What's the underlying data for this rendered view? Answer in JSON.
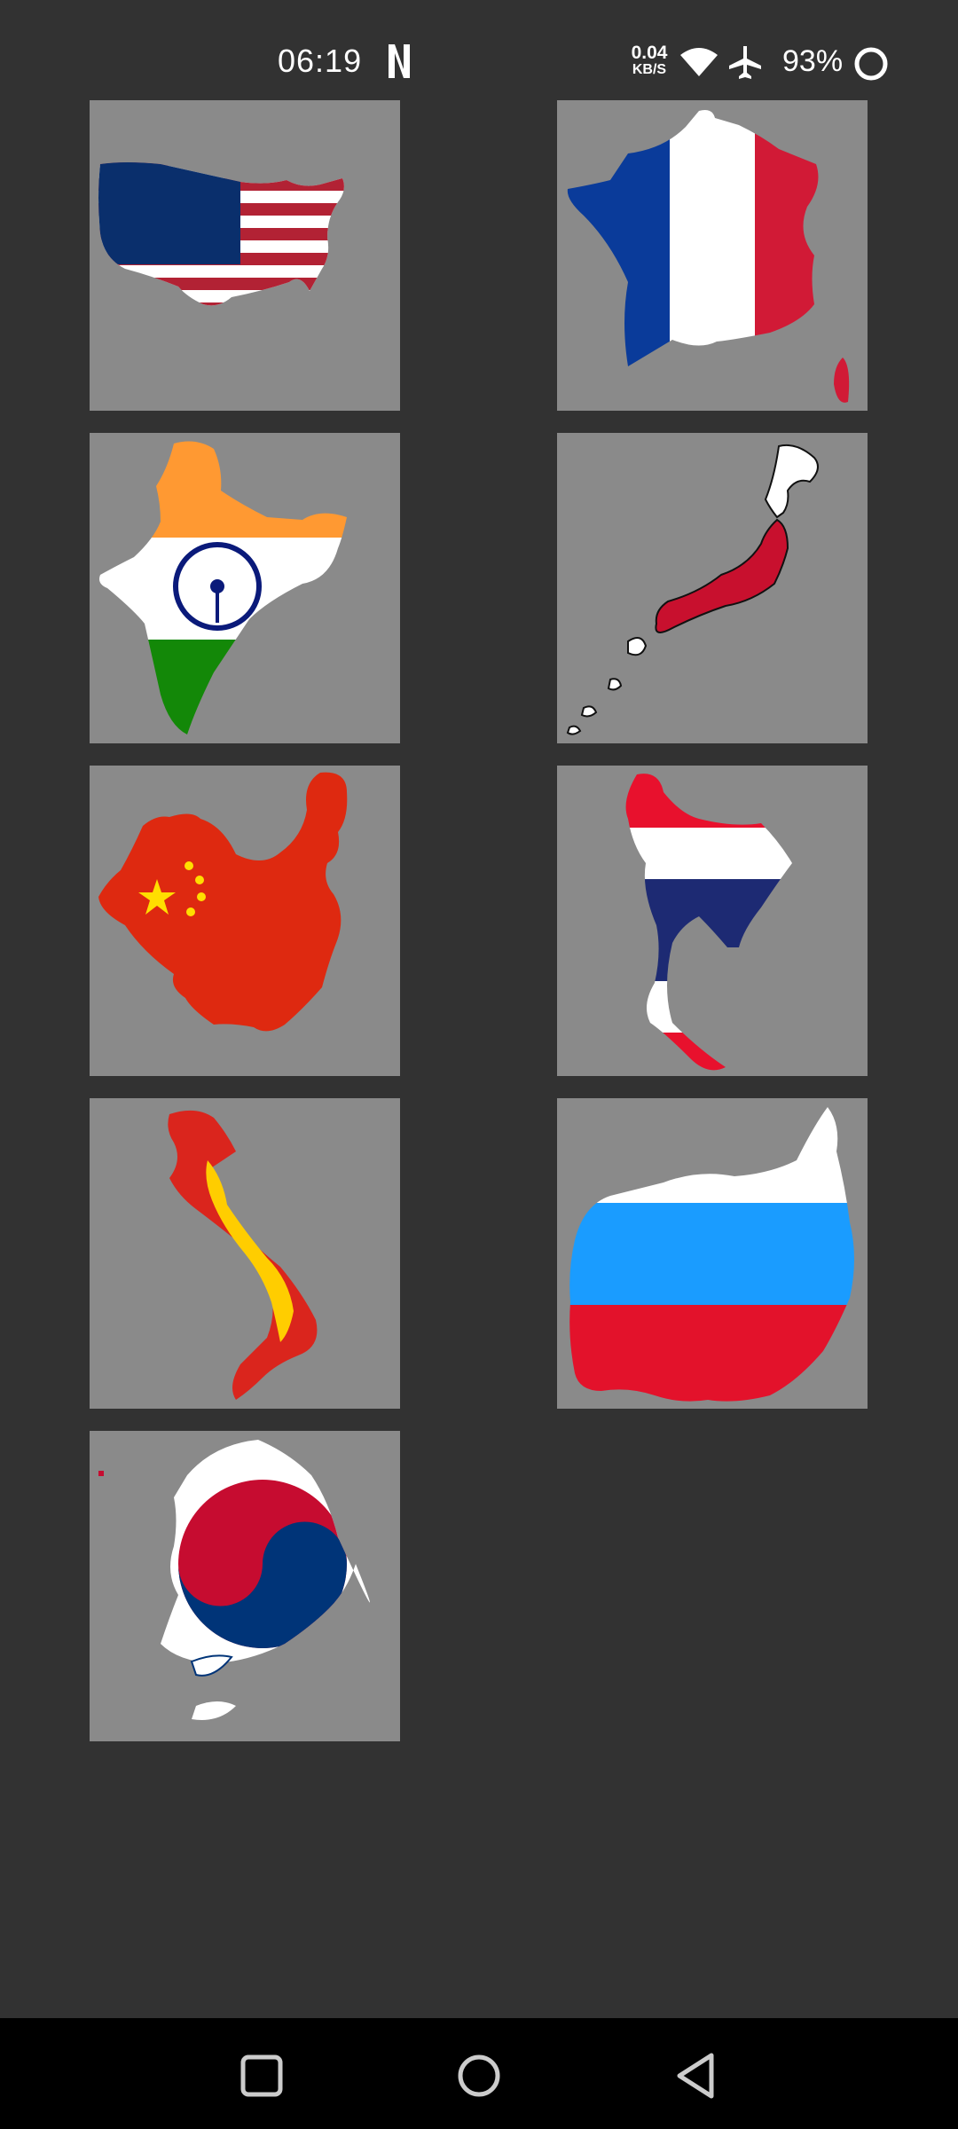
{
  "status_bar": {
    "time": "06:19",
    "net_speed_value": "0.04",
    "net_speed_unit": "KB/S",
    "battery_percent": "93%",
    "icons": [
      "netflix-icon",
      "wifi-icon",
      "airplane-mode-icon",
      "battery-icon"
    ]
  },
  "flag_grid": {
    "tiles": [
      {
        "country": "usa",
        "icon": "usa-flag-map-icon"
      },
      {
        "country": "france",
        "icon": "france-flag-map-icon"
      },
      {
        "country": "india",
        "icon": "india-flag-map-icon"
      },
      {
        "country": "japan",
        "icon": "japan-flag-map-icon"
      },
      {
        "country": "china",
        "icon": "china-flag-map-icon"
      },
      {
        "country": "thailand",
        "icon": "thailand-flag-map-icon"
      },
      {
        "country": "vietnam",
        "icon": "vietnam-flag-map-icon"
      },
      {
        "country": "russia",
        "icon": "russia-flag-map-icon"
      },
      {
        "country": "south-korea",
        "icon": "south-korea-flag-map-icon"
      }
    ]
  },
  "nav_bar": {
    "buttons": [
      "recents-button",
      "home-button",
      "back-button"
    ]
  },
  "colors": {
    "background": "#323232",
    "tile": "#8a8a8a",
    "nav": "#000000"
  }
}
